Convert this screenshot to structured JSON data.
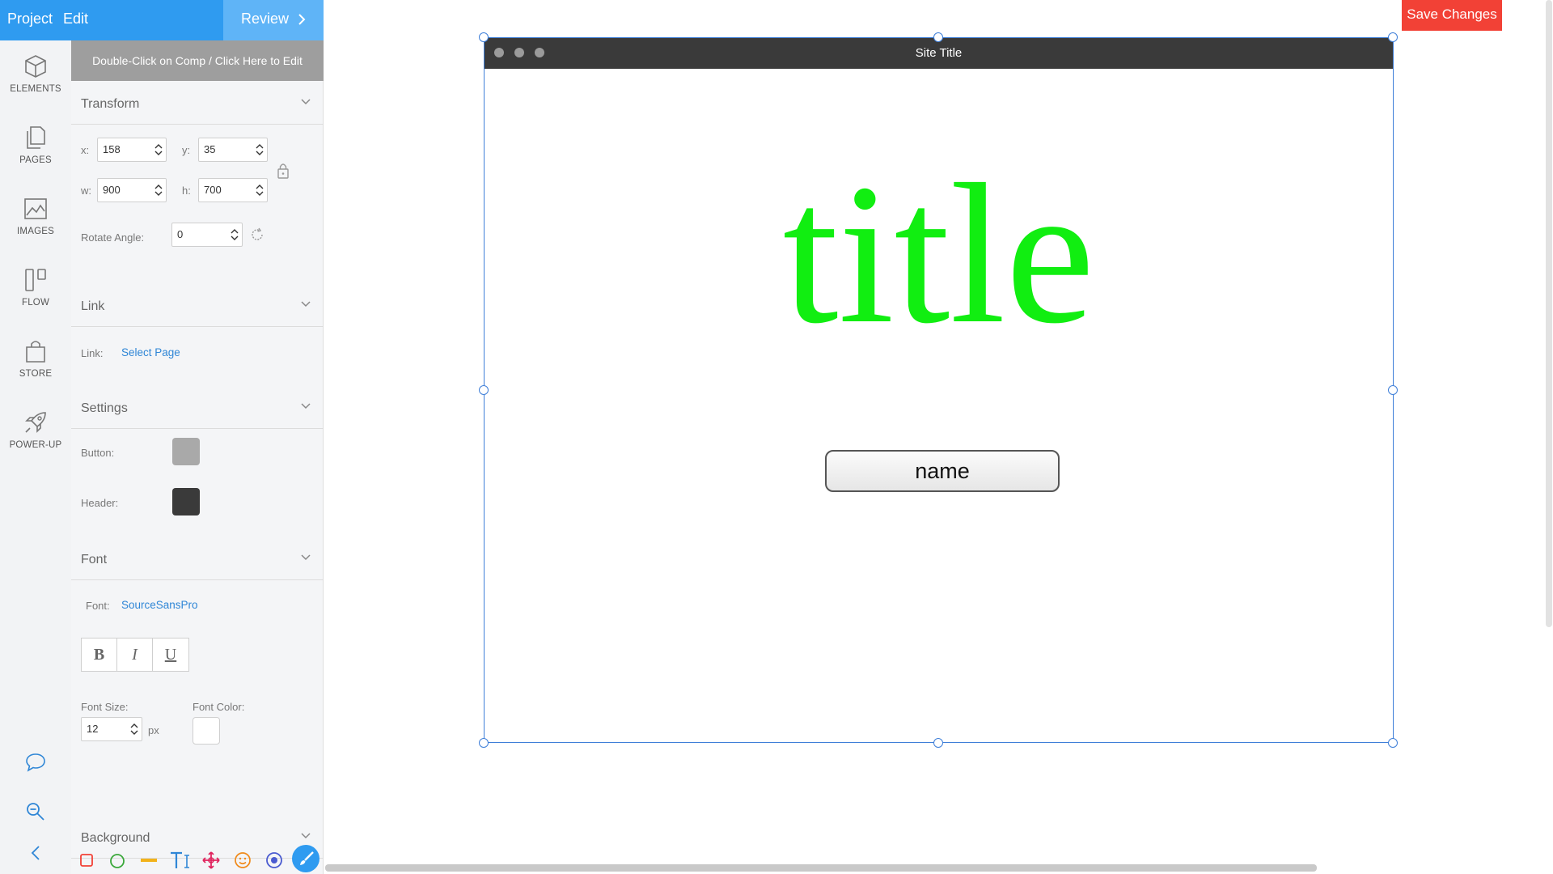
{
  "topbar": {
    "project": "Project",
    "edit": "Edit",
    "review": "Review"
  },
  "rail": {
    "items": [
      {
        "label": "ELEMENTS",
        "icon": "cube-icon"
      },
      {
        "label": "PAGES",
        "icon": "pages-icon"
      },
      {
        "label": "IMAGES",
        "icon": "image-icon"
      },
      {
        "label": "FLOW",
        "icon": "flow-icon"
      },
      {
        "label": "STORE",
        "icon": "shopping-bag-icon"
      },
      {
        "label": "POWER-UP",
        "icon": "rocket-icon"
      }
    ]
  },
  "panel": {
    "banner": "Double-Click on Comp / Click Here to Edit",
    "transform": {
      "title": "Transform",
      "x_label": "x:",
      "x": "158",
      "y_label": "y:",
      "y": "35",
      "w_label": "w:",
      "w": "900",
      "h_label": "h:",
      "h": "700",
      "rotate_label": "Rotate Angle:",
      "rotate": "0"
    },
    "link": {
      "title": "Link",
      "label": "Link:",
      "value": "Select Page"
    },
    "settings": {
      "title": "Settings",
      "button_label": "Button:",
      "button_color": "#a9a9a9",
      "header_label": "Header:",
      "header_color": "#3a3a3a"
    },
    "font": {
      "title": "Font",
      "label": "Font:",
      "value": "SourceSansPro",
      "bold": "B",
      "italic": "I",
      "underline": "U",
      "size_label": "Font Size:",
      "size": "12",
      "size_unit": "px",
      "color_label": "Font Color:"
    },
    "background": {
      "title": "Background"
    }
  },
  "canvas": {
    "save_label": "Save Changes",
    "site_title": "Site Title",
    "big_title": "title",
    "title_color": "#11ee11",
    "name_button": "name"
  },
  "colors": {
    "accent": "#2f9bf0",
    "save": "#f24136",
    "selection": "#3f7fd8"
  }
}
